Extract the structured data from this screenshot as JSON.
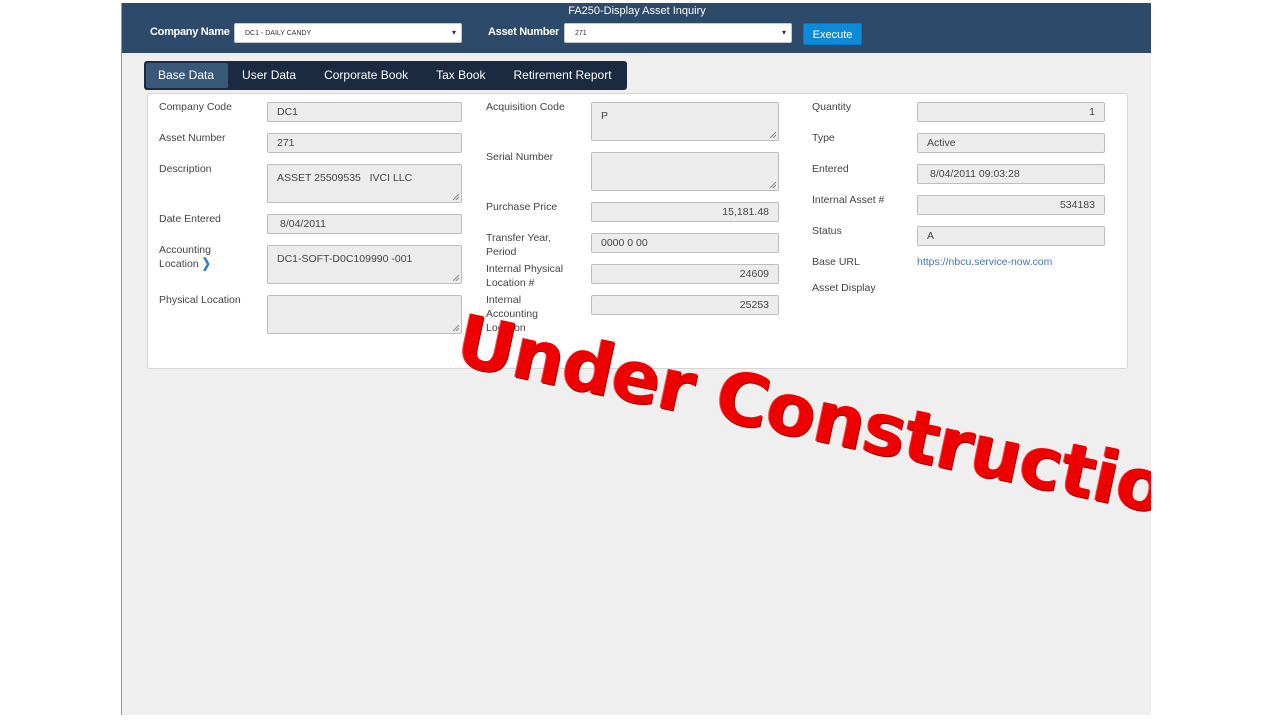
{
  "header": {
    "title": "FA250-Display Asset Inquiry",
    "company_label": "Company Name",
    "company_value": "DC1 - DAILY CANDY",
    "asset_label": "Asset Number",
    "asset_value": "271",
    "execute_label": "Execute",
    "dropdown_icon": "▾"
  },
  "tabs": [
    "Base Data",
    "User Data",
    "Corporate Book",
    "Tax Book",
    "Retirement Report"
  ],
  "fields": {
    "company_code": {
      "label": "Company Code",
      "value": "DC1"
    },
    "asset_number": {
      "label": "Asset Number",
      "value": "271"
    },
    "description": {
      "label": "Description",
      "value": "ASSET 25509535   IVCI LLC"
    },
    "date_entered": {
      "label": "Date Entered",
      "value": "8/04/2011"
    },
    "accounting_location": {
      "label_line1": "Accounting",
      "label_line2": "Location",
      "value": "DC1-SOFT-D0C109990 -001",
      "chevron": "❯"
    },
    "physical_location": {
      "label": "Physical Location",
      "value": ""
    },
    "acquisition_code": {
      "label": "Acquisition Code",
      "value": "P"
    },
    "serial_number": {
      "label": "Serial Number",
      "value": ""
    },
    "purchase_price": {
      "label": "Purchase Price",
      "value": "15,181.48"
    },
    "transfer_year_period": {
      "label_line1": "Transfer Year,",
      "label_line2": "Period",
      "value": "0000 0 00"
    },
    "internal_physical_location": {
      "label_line1": "Internal Physical",
      "label_line2": "Location #",
      "value": "24609"
    },
    "internal_accounting_location": {
      "label_line1": "Internal",
      "label_line2": "Accounting",
      "label_line3": "Location",
      "value": "25253"
    },
    "quantity": {
      "label": "Quantity",
      "value": "1"
    },
    "type": {
      "label": "Type",
      "value": "Active"
    },
    "entered": {
      "label": "Entered",
      "value": "8/04/2011 09:03:28"
    },
    "internal_asset": {
      "label": "Internal Asset #",
      "value": "534183"
    },
    "status": {
      "label": "Status",
      "value": "A"
    },
    "base_url": {
      "label": "Base URL",
      "value": "https://nbcu.service-now.com"
    },
    "asset_display": {
      "label": "Asset Display"
    }
  },
  "overlay": {
    "text": "Under Construction",
    "color": "#ee0000"
  },
  "colors": {
    "header_bg": "#2e4a6b",
    "tab_bar_bg": "#1b2a40",
    "execute_bg": "#0d8ad8",
    "link": "#3d7ab8"
  }
}
